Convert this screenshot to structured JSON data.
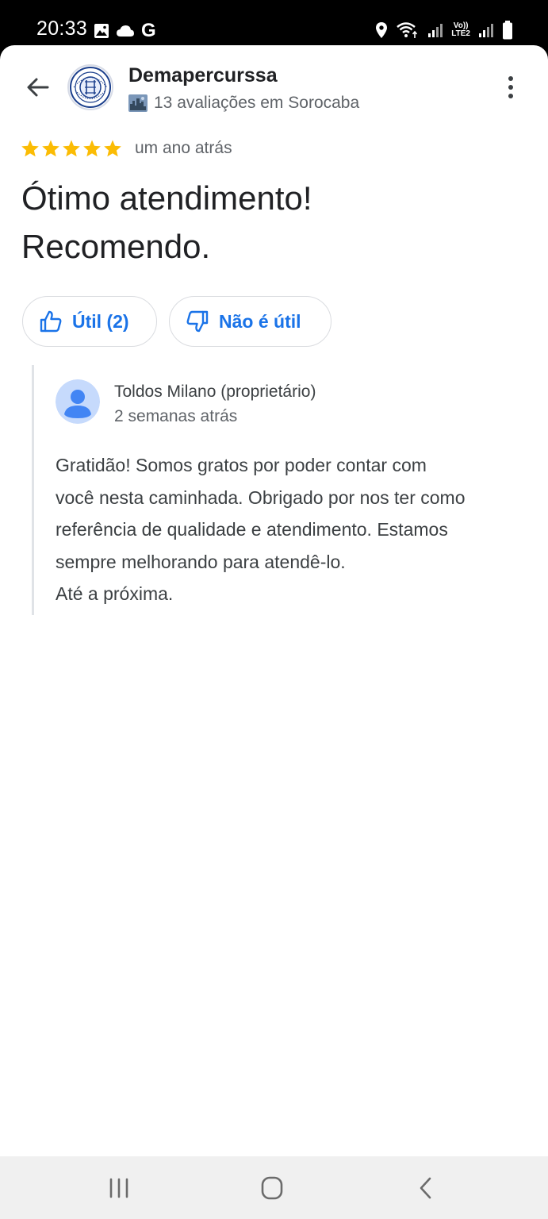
{
  "status_bar": {
    "time": "20:33",
    "left_icons": [
      "image-icon",
      "cloud-icon",
      "google-g-icon"
    ],
    "google_letter": "G",
    "right_icons": [
      "location-icon",
      "wifi-icon",
      "signal-icon",
      "volte-icon",
      "signal-icon",
      "battery-icon"
    ],
    "volte_line1": "Vo))",
    "volte_line2": "LTE2"
  },
  "header": {
    "back_icon": "arrow-left-icon",
    "avatar_icon": "club-crest-icon",
    "reviewer_name": "Demapercurssa",
    "reviewer_meta": "13 avaliações em Sorocaba",
    "badge_icon": "local-guide-badge-icon",
    "menu_icon": "more-vert-icon"
  },
  "review": {
    "stars": 5,
    "stars_max": 5,
    "star_color": "#fbbc04",
    "date": "um ano atrás",
    "text_line1": "Ótimo atendimento!",
    "text_line2": "Recomendo."
  },
  "actions": {
    "helpful_label": "Útil (2)",
    "not_helpful_label": "Não é útil",
    "accent_color": "#1a73e8"
  },
  "owner_reply": {
    "avatar_icon": "default-user-avatar-icon",
    "name": "Toldos Milano (proprietário)",
    "date": "2 semanas atrás",
    "text": "Gratidão! Somos gratos por poder contar com\nvocê nesta caminhada. Obrigado por nos ter como\nreferência de qualidade e atendimento. Estamos\nsempre melhorando para atendê-lo.\nAté a próxima."
  },
  "nav_bar": {
    "buttons": [
      "recents-icon",
      "home-icon",
      "back-icon"
    ]
  }
}
